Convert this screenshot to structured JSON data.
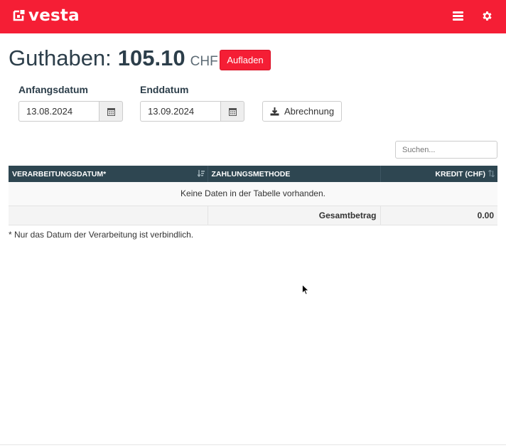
{
  "brand": {
    "name": "vesta",
    "color": "#f51e35"
  },
  "header": {
    "menu_icon": "hamburger-icon",
    "settings_icon": "gear-icon"
  },
  "balance": {
    "label": "Guthaben:",
    "amount": "105.10",
    "currency": "CHF",
    "topup_label": "Aufladen"
  },
  "filters": {
    "start_label": "Anfangsdatum",
    "start_value": "13.08.2024",
    "end_label": "Enddatum",
    "end_value": "13.09.2024",
    "export_label": "Abrechnung"
  },
  "search": {
    "placeholder": "Suchen..."
  },
  "table": {
    "columns": [
      "VERARBEITUNGSDATUM*",
      "ZAHLUNGSMETHODE",
      "KREDIT (CHF)"
    ],
    "empty_message": "Keine Daten in der Tabelle vorhanden.",
    "footer": {
      "label": "Gesamtbetrag",
      "value": "0.00"
    },
    "header_bg": "#2e4651"
  },
  "footnote": "* Nur das Datum der Verarbeitung ist verbindlich."
}
